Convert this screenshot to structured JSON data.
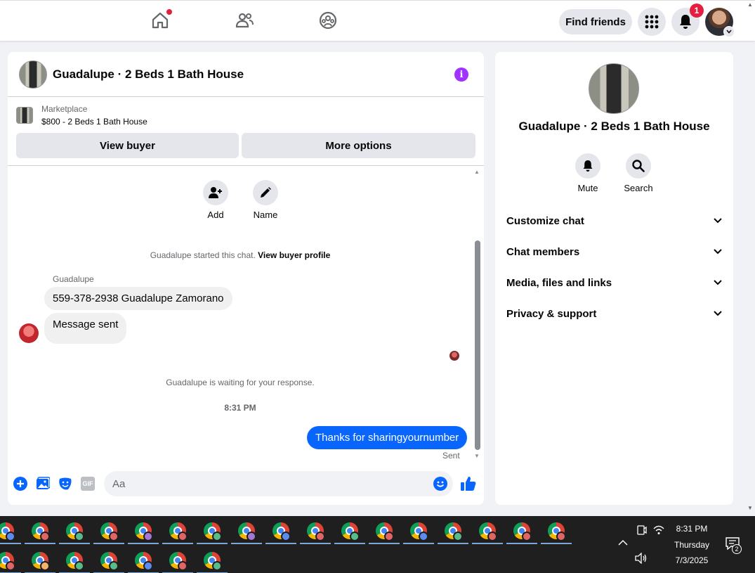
{
  "topbar": {
    "nav_icons": [
      "home-icon",
      "friends-icon",
      "groups-icon"
    ],
    "find_friends_label": "Find friends",
    "menu_icon": "grid-menu-icon",
    "notification_icon": "bell-icon",
    "notification_count": "1",
    "profile_chevron_icon": "chevron-down-icon"
  },
  "chat": {
    "title": "Guadalupe · 2 Beds 1 Bath House",
    "info_icon_glyph": "i",
    "marketplace_label": "Marketplace",
    "listing_title": "$800 - 2 Beds 1 Bath House",
    "view_buyer_label": "View buyer",
    "more_options_label": "More options",
    "actions": [
      {
        "label": "Add",
        "icon": "add-person-icon"
      },
      {
        "label": "Name",
        "icon": "pencil-icon"
      }
    ],
    "started_text": "Guadalupe started this chat.",
    "view_buyer_profile_label": "View buyer profile",
    "sender_name": "Guadalupe",
    "messages_in": [
      "559-378-2938 Guadalupe Zamorano",
      "Message sent"
    ],
    "waiting_text": "Guadalupe is waiting for your response.",
    "timestamp": "8:31 PM",
    "message_out": "Thanks for sharingyournumber",
    "sent_status": "Sent",
    "composer_placeholder": "Aa",
    "composer_icons": [
      "plus-circle-icon",
      "photo-icon",
      "sticker-icon",
      "gif-icon",
      "emoji-icon",
      "thumbs-up-icon"
    ],
    "gif_glyph": "GIF"
  },
  "info_panel": {
    "title": "Guadalupe · 2 Beds 1 Bath House",
    "actions": [
      {
        "label": "Mute",
        "icon": "bell-icon"
      },
      {
        "label": "Search",
        "icon": "search-icon"
      }
    ],
    "sections": [
      "Customize chat",
      "Chat members",
      "Media, files and links",
      "Privacy & support"
    ],
    "chevron_glyph": "⌄"
  },
  "taskbar": {
    "time": "8:31 PM",
    "day": "Thursday",
    "date": "7/3/2025",
    "notification_count": "2",
    "tray_icons": [
      "chevron-up-icon",
      "meet-icon",
      "wifi-icon",
      "volume-icon",
      "notifications-icon"
    ],
    "app_profile_colors": [
      "#5b8def",
      "#e06666",
      "#57bb8a",
      "#e06666",
      "#a678d6",
      "#e06666",
      "#57bb8a",
      "#a678d6",
      "#5b8def",
      "#e06666",
      "#57bb8a",
      "#e06666",
      "#5b8def",
      "#57bb8a",
      "#e06666",
      "#e06666",
      "#e06666",
      "#e06666",
      "#f6b26b",
      "#57bb8a",
      "#57bb8a",
      "#5b8def",
      "#e06666",
      "#57bb8a"
    ]
  },
  "colors": {
    "accent_blue": "#0866ff",
    "info_purple": "#a033ff",
    "badge_red": "#e41e3f"
  }
}
